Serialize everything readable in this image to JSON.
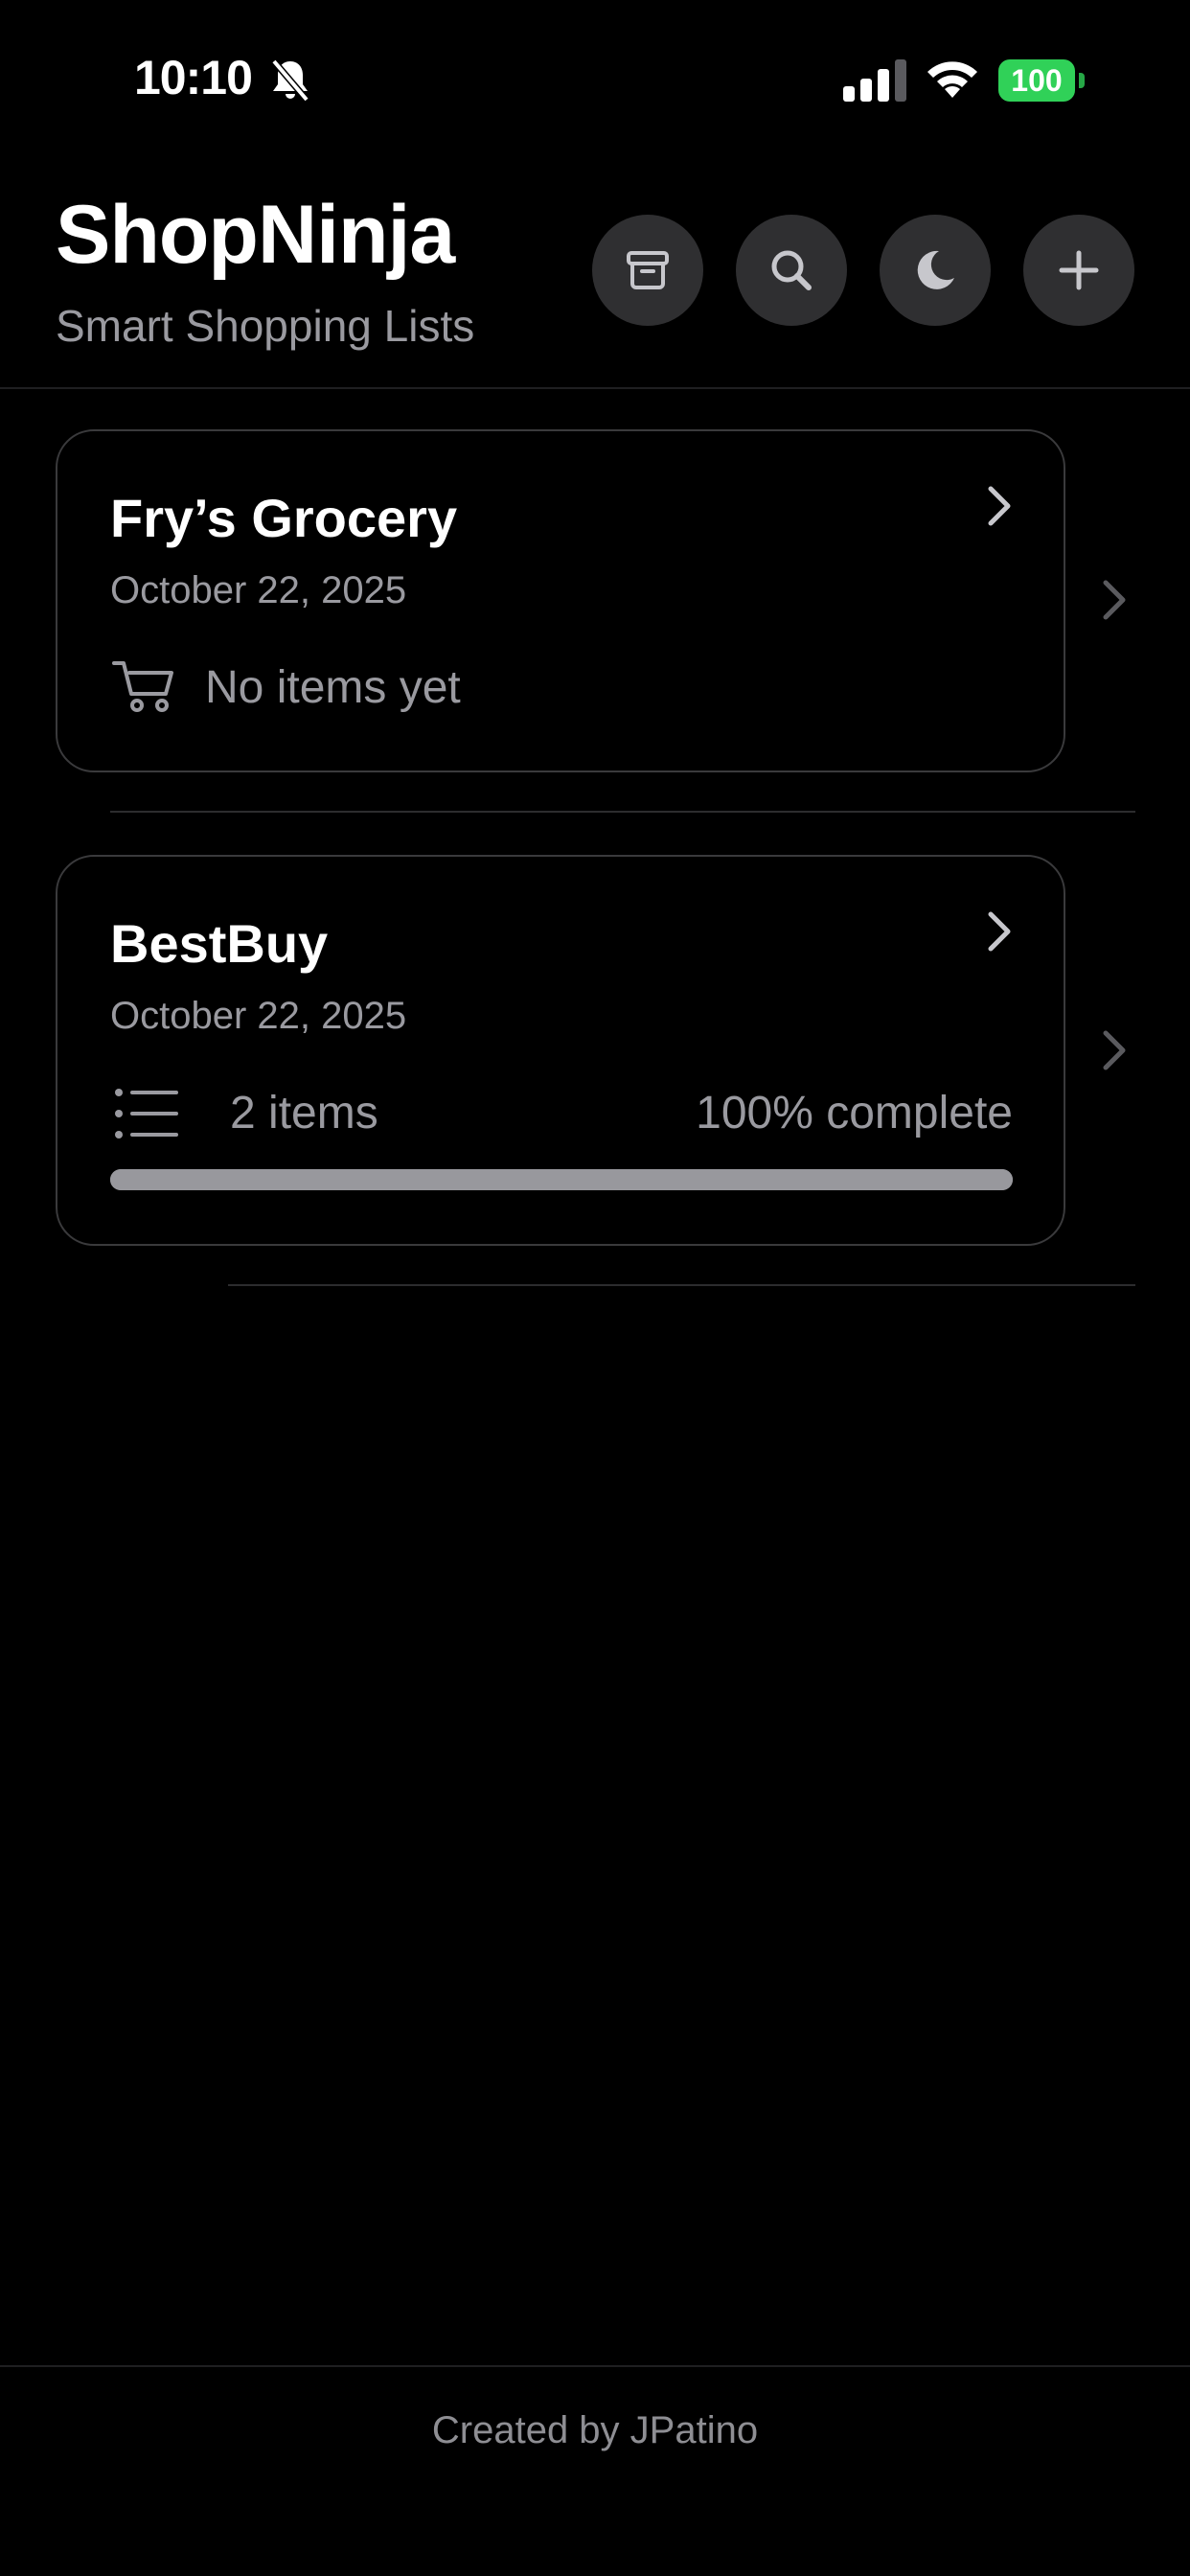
{
  "status_bar": {
    "time": "10:10",
    "battery": "100"
  },
  "header": {
    "title": "ShopNinja",
    "subtitle": "Smart Shopping Lists"
  },
  "lists": [
    {
      "name": "Fry’s Grocery",
      "date": "October 22, 2025",
      "summary": "No items yet"
    },
    {
      "name": "BestBuy",
      "date": "October 22, 2025",
      "count": "2 items",
      "progress_label": "100% complete",
      "progress": 1.0
    }
  ],
  "footer": {
    "text": "Created by JPatino"
  },
  "colors": {
    "background": "#000000",
    "button_bg": "#2f2f31",
    "battery": "#30d158",
    "muted_text": "#9a9aa0"
  }
}
